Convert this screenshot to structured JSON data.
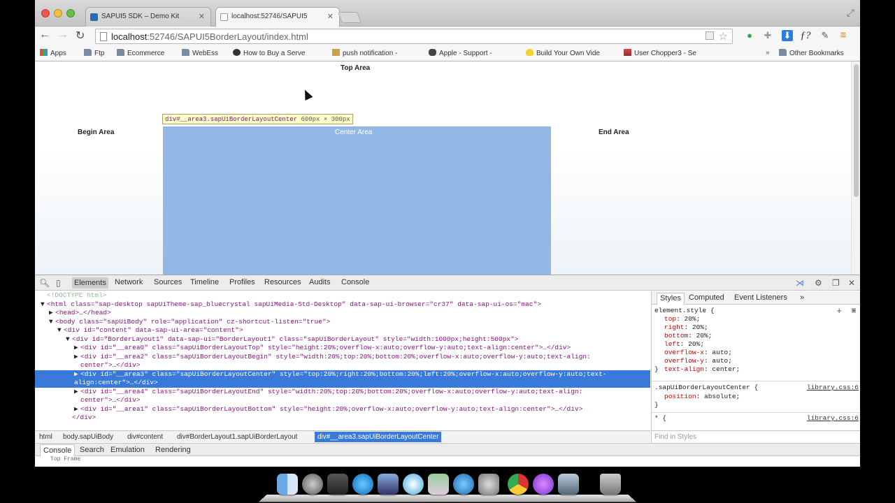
{
  "browser": {
    "tabs": [
      {
        "label": "SAPUI5 SDK – Demo Kit",
        "active": false
      },
      {
        "label": "localhost:52746/SAPUI5",
        "active": true
      }
    ],
    "url_host": "localhost",
    "url_rest": ":52746/SAPUI5BorderLayout/index.html",
    "bookmarks": [
      {
        "label": "Apps",
        "icon": "apps-grid-icon"
      },
      {
        "label": "Ftp",
        "icon": "folder-icon"
      },
      {
        "label": "Ecommerce",
        "icon": "folder-icon"
      },
      {
        "label": "WebEss",
        "icon": "folder-icon"
      },
      {
        "label": "How to Buy a Serve",
        "icon": "globe-icon"
      },
      {
        "label": "push notification - ",
        "icon": "page-icon"
      },
      {
        "label": "Apple - Support - ",
        "icon": "apple-icon"
      },
      {
        "label": "Build Your Own Vide",
        "icon": "bulb-icon"
      },
      {
        "label": "User Chopper3 - Se",
        "icon": "site-icon"
      },
      {
        "label": "Other Bookmarks",
        "icon": "folder-icon"
      }
    ],
    "overflow_chevron": "»"
  },
  "page": {
    "top_area": "Top Area",
    "begin_area": "Begin Area",
    "center_area": "Center Area",
    "end_area": "End Area",
    "inspect_tooltip": {
      "selector": "div#__area3.sapUiBorderLayoutCenter",
      "size": "600px × 300px"
    }
  },
  "devtools": {
    "tabs": [
      "Elements",
      "Network",
      "Sources",
      "Timeline",
      "Profiles",
      "Resources",
      "Audits",
      "Console"
    ],
    "selected_tab": "Elements",
    "dom_lines": [
      {
        "indent": 0,
        "arrow": "",
        "text": "<!DOCTYPE html>"
      },
      {
        "indent": 0,
        "arrow": "▼",
        "text": "<html class=\"sap-desktop  sapUiTheme-sap_bluecrystal sapUiMedia-Std-Desktop\" data-sap-ui-browser=\"cr37\" data-sap-ui-os=\"mac\">"
      },
      {
        "indent": 1,
        "arrow": "▶",
        "text": "<head>…</head>"
      },
      {
        "indent": 1,
        "arrow": "▼",
        "text": "<body class=\"sapUiBody\" role=\"application\" cz-shortcut-listen=\"true\">"
      },
      {
        "indent": 2,
        "arrow": "▼",
        "text": "<div id=\"content\" data-sap-ui-area=\"content\">"
      },
      {
        "indent": 3,
        "arrow": "▼",
        "text": "<div id=\"BorderLayout1\" data-sap-ui=\"BorderLayout1\" class=\"sapUiBorderLayout\" style=\"width:1000px;height:500px\">"
      },
      {
        "indent": 4,
        "arrow": "▶",
        "text": "<div id=\"__area0\" class=\"sapUiBorderLayoutTop\" style=\"height:20%;overflow-x:auto;overflow-y:auto;text-align:center\">…</div>"
      },
      {
        "indent": 4,
        "arrow": "▶",
        "text": "<div id=\"__area2\" class=\"sapUiBorderLayoutBegin\" style=\"width:20%;top:20%;bottom:20%;overflow-x:auto;overflow-y:auto;text-align:"
      },
      {
        "indent": 4,
        "arrow": "",
        "text": "center\">…</div>"
      },
      {
        "indent": 4,
        "arrow": "▶",
        "text": "<div id=\"__area3\" class=\"sapUiBorderLayoutCenter\" style=\"top:20%;right:20%;bottom:20%;left:20%;overflow-x:auto;overflow-y:auto;text-"
      },
      {
        "indent": 4,
        "arrow": "",
        "text": "align:center\">…</div>"
      },
      {
        "indent": 4,
        "arrow": "▶",
        "text": "<div id=\"__area4\" class=\"sapUiBorderLayoutEnd\" style=\"width:20%;top:20%;bottom:20%;overflow-x:auto;overflow-y:auto;text-align:"
      },
      {
        "indent": 4,
        "arrow": "",
        "text": "center\">…</div>"
      },
      {
        "indent": 4,
        "arrow": "▶",
        "text": "<div id=\"__area1\" class=\"sapUiBorderLayoutBottom\" style=\"height:20%;overflow-x:auto;overflow-y:auto;text-align:center\">…</div>"
      },
      {
        "indent": 3,
        "arrow": "",
        "text": "</div>"
      }
    ],
    "styles_tabs": [
      "Styles",
      "Computed",
      "Event Listeners"
    ],
    "styles_more": "»",
    "element_style_header": "element.style {",
    "element_style_props": [
      {
        "name": "top",
        "value": "20%;"
      },
      {
        "name": "right",
        "value": "20%;"
      },
      {
        "name": "bottom",
        "value": "20%;"
      },
      {
        "name": "left",
        "value": "20%;"
      },
      {
        "name": "overflow-x",
        "value": "auto;"
      },
      {
        "name": "overflow-y",
        "value": "auto;"
      },
      {
        "name": "text-align",
        "value": "center;"
      }
    ],
    "close_brace": "}",
    "rule2_selector": ".sapUiBorderLayoutCenter {",
    "rule2_source": "library.css:6",
    "rule2_prop": {
      "name": "position",
      "value": "absolute;"
    },
    "rule3_selector": "* {",
    "rule3_source": "library.css:6",
    "breadcrumbs": [
      "html",
      "body.sapUiBody",
      "div#content",
      "div#BorderLayout1.sapUiBorderLayout",
      "div#__area3.sapUiBorderLayoutCenter"
    ],
    "find_in_styles": "Find in Styles",
    "drawer_tabs": [
      "Console",
      "Search",
      "Emulation",
      "Rendering"
    ],
    "console_line": "Top Frame"
  },
  "colors": {
    "center_highlight": "#93b8e5",
    "selection": "#3879d9"
  }
}
